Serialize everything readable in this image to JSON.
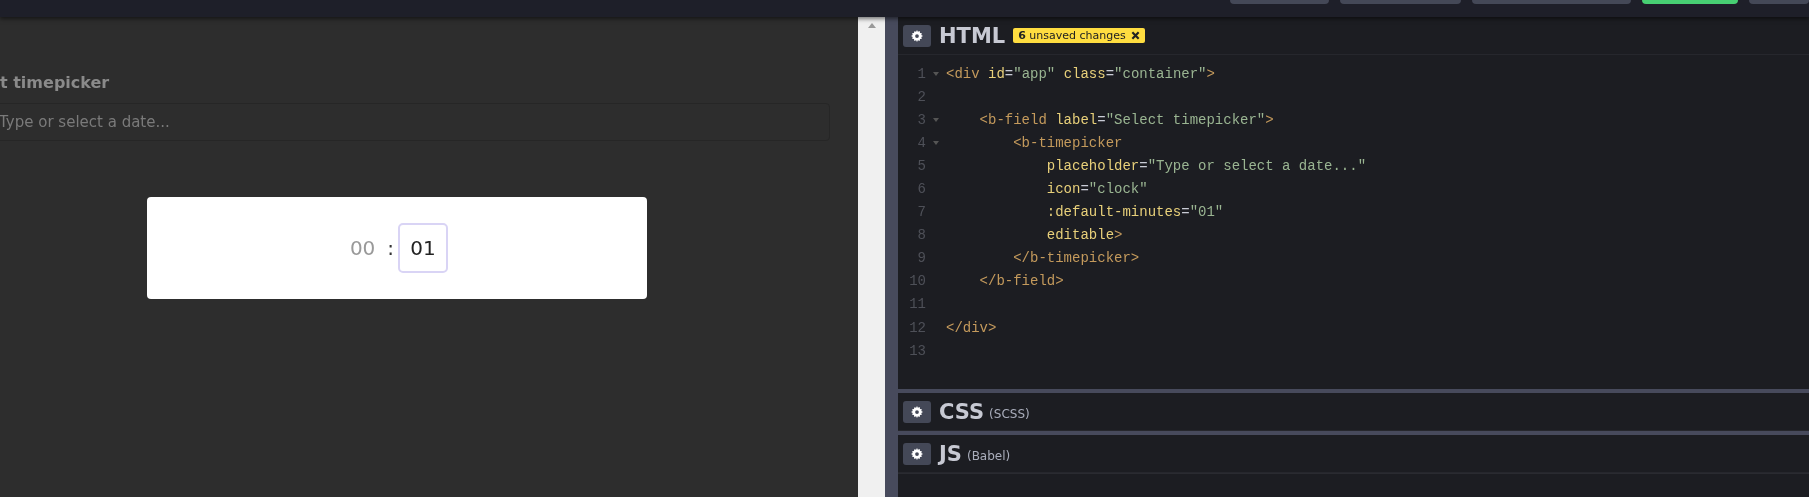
{
  "toolbar": {
    "buttons": [
      {
        "kind": "plain"
      },
      {
        "kind": "plain"
      },
      {
        "kind": "plain"
      },
      {
        "kind": "primary"
      },
      {
        "kind": "plain"
      }
    ]
  },
  "preview": {
    "field_label": "t timepicker",
    "field": {
      "placeholder": "Type or select a date..."
    },
    "timepicker": {
      "hours": "00",
      "separator": ":",
      "minutes": "01",
      "minutes_focused": true
    }
  },
  "editors": [
    {
      "title": "HTML",
      "badge": "**6** unsaved changes",
      "expanded": true,
      "lines": [
        {
          "number": "1",
          "foldable": true,
          "tokens": [
            {
              "kind": "tag",
              "text": "<div "
            },
            {
              "kind": "attr",
              "text": "id"
            },
            {
              "kind": "punct",
              "text": "="
            },
            {
              "kind": "string",
              "text": "\"app\""
            },
            {
              "kind": "attr",
              "text": " class"
            },
            {
              "kind": "punct",
              "text": "="
            },
            {
              "kind": "string",
              "text": "\"container\""
            },
            {
              "kind": "tag",
              "text": ">"
            }
          ]
        },
        {
          "number": "2",
          "foldable": false
        },
        {
          "number": "3",
          "foldable": true,
          "tokens": [
            {
              "kind": "tag",
              "text": "    <b-field "
            },
            {
              "kind": "attr",
              "text": "label"
            },
            {
              "kind": "punct",
              "text": "="
            },
            {
              "kind": "string",
              "text": "\"Select timepicker\""
            },
            {
              "kind": "tag",
              "text": ">"
            }
          ]
        },
        {
          "number": "4",
          "foldable": true,
          "tokens": [
            {
              "kind": "tag",
              "text": "        <b-timepicker"
            }
          ]
        },
        {
          "number": "5",
          "foldable": false,
          "tokens": [
            {
              "kind": "attr",
              "text": "            placeholder"
            },
            {
              "kind": "punct",
              "text": "="
            },
            {
              "kind": "string",
              "text": "\"Type or select a date...\""
            }
          ]
        },
        {
          "number": "6",
          "foldable": false,
          "tokens": [
            {
              "kind": "attr",
              "text": "            icon"
            },
            {
              "kind": "punct",
              "text": "="
            },
            {
              "kind": "string",
              "text": "\"clock\""
            }
          ]
        },
        {
          "number": "7",
          "foldable": false,
          "tokens": [
            {
              "kind": "attr",
              "text": "            :default-minutes"
            },
            {
              "kind": "punct",
              "text": "="
            },
            {
              "kind": "string",
              "text": "\"01\""
            }
          ]
        },
        {
          "number": "8",
          "foldable": false,
          "tokens": [
            {
              "kind": "attr",
              "text": "            editable"
            },
            {
              "kind": "tag",
              "text": ">"
            }
          ]
        },
        {
          "number": "9",
          "foldable": false,
          "tokens": [
            {
              "kind": "tag",
              "text": "        </b-timepicker>"
            }
          ]
        },
        {
          "number": "10",
          "foldable": false,
          "tokens": [
            {
              "kind": "tag",
              "text": "    </b-field>"
            }
          ]
        },
        {
          "number": "11",
          "foldable": false
        },
        {
          "number": "12",
          "foldable": false,
          "tokens": [
            {
              "kind": "tag",
              "text": "</div>"
            }
          ]
        },
        {
          "number": "13",
          "foldable": false
        }
      ]
    },
    {
      "title": "CSS",
      "subtitle": "(SCSS)",
      "expanded": false
    },
    {
      "title": "JS",
      "subtitle": "(Babel)",
      "expanded": false
    }
  ]
}
